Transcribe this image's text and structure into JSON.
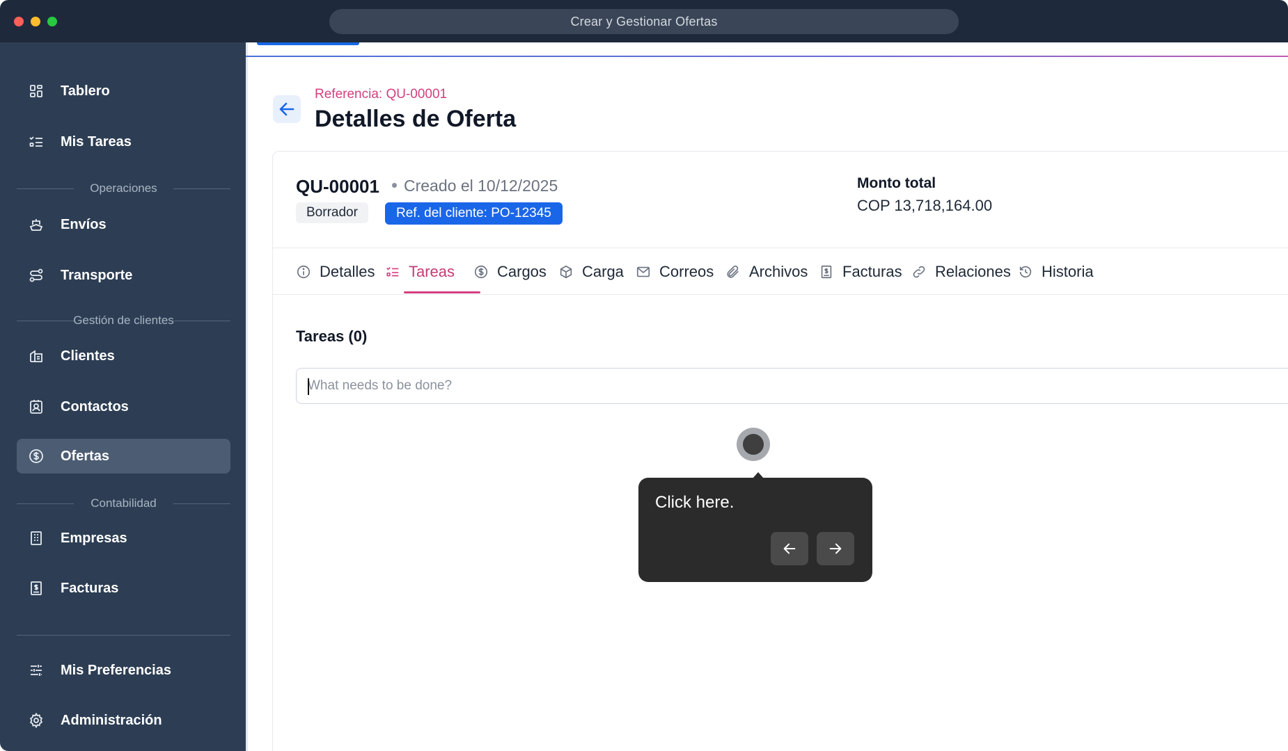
{
  "window": {
    "title": "Crear y Gestionar Ofertas"
  },
  "sidebar": {
    "items": [
      {
        "label": "Tablero",
        "icon": "dashboard-icon"
      },
      {
        "label": "Mis Tareas",
        "icon": "tasks-icon"
      },
      {
        "label": "Envíos",
        "icon": "ship-icon"
      },
      {
        "label": "Transporte",
        "icon": "route-icon"
      },
      {
        "label": "Clientes",
        "icon": "building-icon"
      },
      {
        "label": "Contactos",
        "icon": "contact-icon"
      },
      {
        "label": "Ofertas",
        "icon": "dollar-circle-icon",
        "active": true
      },
      {
        "label": "Empresas",
        "icon": "company-icon"
      },
      {
        "label": "Facturas",
        "icon": "invoice-icon"
      },
      {
        "label": "Mis Preferencias",
        "icon": "sliders-icon"
      },
      {
        "label": "Administración",
        "icon": "gear-icon"
      }
    ],
    "sections": [
      "Operaciones",
      "Gestión de clientes",
      "Contabilidad"
    ]
  },
  "header": {
    "reference": "Referencia: QU-00001",
    "title": "Detalles de Oferta"
  },
  "quote": {
    "id": "QU-00001",
    "created": "Creado el 10/12/2025",
    "status": "Borrador",
    "client_ref": "Ref. del cliente: PO-12345",
    "total_label": "Monto total",
    "total_value": "COP 13,718,164.00"
  },
  "tabs": [
    {
      "label": "Detalles",
      "icon": "info-icon"
    },
    {
      "label": "Tareas",
      "icon": "tasks-icon",
      "active": true
    },
    {
      "label": "Cargos",
      "icon": "dollar-circle-icon"
    },
    {
      "label": "Carga",
      "icon": "box-icon"
    },
    {
      "label": "Correos",
      "icon": "mail-icon"
    },
    {
      "label": "Archivos",
      "icon": "paperclip-icon"
    },
    {
      "label": "Facturas",
      "icon": "invoice-icon"
    },
    {
      "label": "Relaciones",
      "icon": "link-icon"
    },
    {
      "label": "Historia",
      "icon": "history-icon"
    }
  ],
  "tasks": {
    "title": "Tareas (0)",
    "input_placeholder": "What needs to be done?",
    "input_value": ""
  },
  "tooltip": {
    "message": "Click here."
  },
  "colors": {
    "sidebar": "#2d3e54",
    "accent": "#d63f80",
    "primary": "#1a66e8"
  }
}
